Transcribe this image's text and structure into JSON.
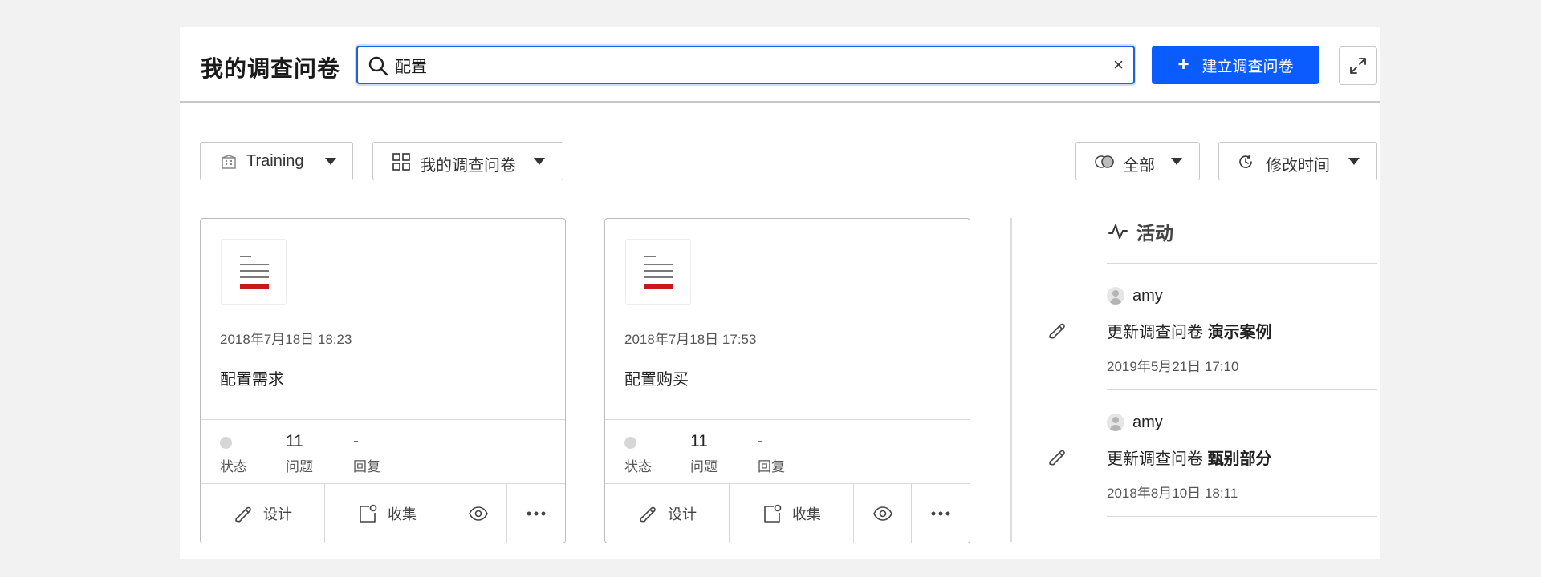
{
  "header": {
    "title": "我的调查问卷",
    "search_value": "配置",
    "clear_label": "×",
    "create_label": "建立调查问卷"
  },
  "filters": {
    "workspace": "Training",
    "scope": "我的调查问卷",
    "status": "全部",
    "sort": "修改时间"
  },
  "cards": [
    {
      "date": "2018年7月18日 18:23",
      "name": "配置需求",
      "questions": "11",
      "replies": "-",
      "status_label": "状态",
      "questions_label": "问题",
      "replies_label": "回复",
      "design_label": "设计",
      "collect_label": "收集"
    },
    {
      "date": "2018年7月18日 17:53",
      "name": "配置购买",
      "questions": "11",
      "replies": "-",
      "status_label": "状态",
      "questions_label": "问题",
      "replies_label": "回复",
      "design_label": "设计",
      "collect_label": "收集"
    }
  ],
  "activity": {
    "title": "活动",
    "entries": [
      {
        "user": "amy",
        "action": "更新调查问卷",
        "target": "演示案例",
        "time": "2019年5月21日 17:10"
      },
      {
        "user": "amy",
        "action": "更新调查问卷",
        "target": "甄别部分",
        "time": "2018年8月10日 18:11"
      }
    ]
  },
  "colors": {
    "primary": "#0b5cff",
    "accent_red": "#c8181d",
    "search_border": "#1f5fe0"
  }
}
